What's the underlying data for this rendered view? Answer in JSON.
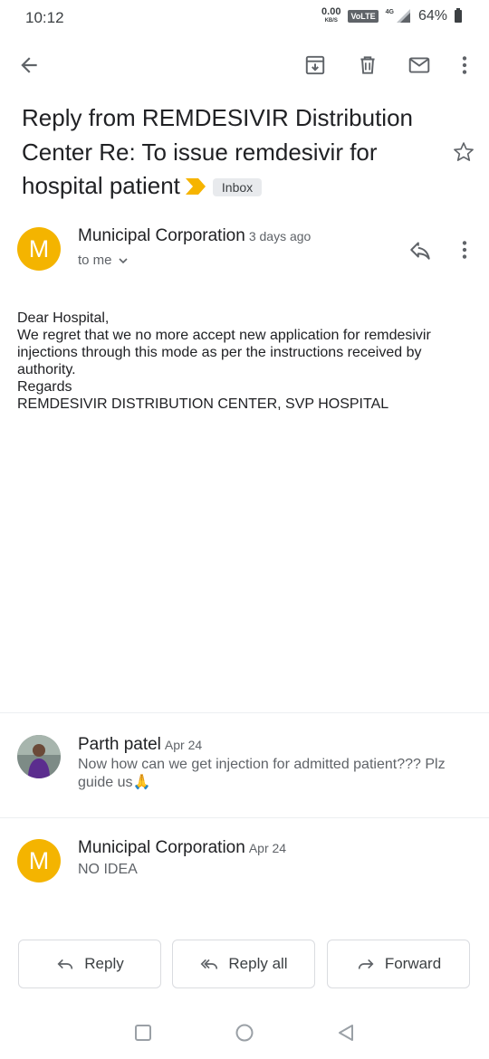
{
  "status_bar": {
    "time": "10:12",
    "net_speed": "0.00",
    "net_unit": "KB/S",
    "volte": "VoLTE",
    "network_type": "4G",
    "battery": "64%"
  },
  "subject": {
    "text": "Reply from REMDESIVIR Distribution Center Re: To issue remdesivir for hospital patient",
    "label": "Inbox"
  },
  "message": {
    "avatar_letter": "M",
    "sender": "Municipal Corporation",
    "time": "3 days ago",
    "recipient": "to me",
    "body_lines": [
      "Dear Hospital,",
      "We regret that we no more accept new application for remdesivir injections through this mode as per the instructions received by authority.",
      "Regards",
      "REMDESIVIR DISTRIBUTION CENTER, SVP HOSPITAL"
    ]
  },
  "thread": [
    {
      "sender": "Parth patel",
      "date": "Apr 24",
      "snippet": "Now how can we get injection for admitted patient??? Plz guide us🙏"
    },
    {
      "avatar_letter": "M",
      "sender": "Municipal Corporation",
      "date": "Apr 24",
      "snippet": "NO IDEA"
    }
  ],
  "actions": {
    "reply": "Reply",
    "reply_all": "Reply all",
    "forward": "Forward"
  },
  "colors": {
    "avatar_yellow": "#f4b400",
    "importance_marker": "#f6b400",
    "icon_gray": "#5f6368"
  }
}
